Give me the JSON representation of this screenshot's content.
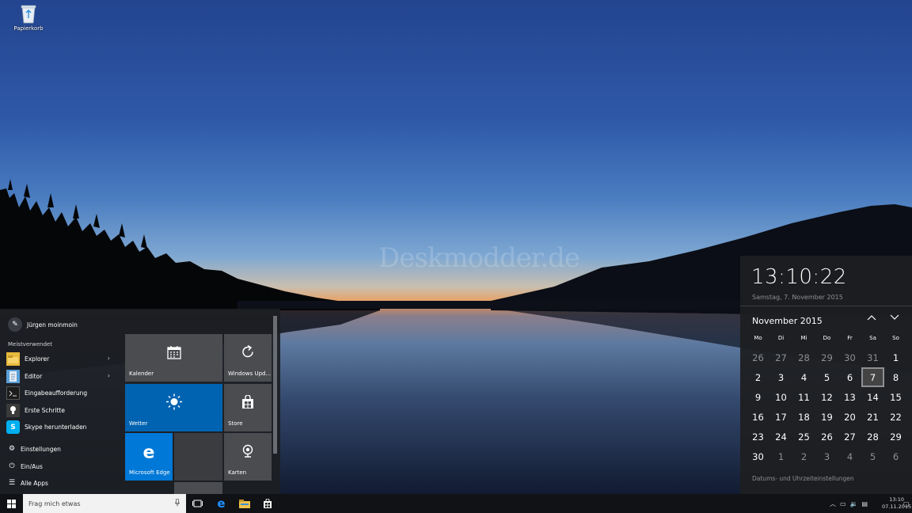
{
  "desktop": {
    "recycle_bin_label": "Papierkorb",
    "watermark": "Deskmodder.de"
  },
  "start_menu": {
    "user_name": "Jürgen moinmoin",
    "most_used_title": "Meistverwendet",
    "apps": [
      {
        "label": "Explorer",
        "icon": "folder-icon",
        "color": "#e7b93c",
        "has_submenu": true
      },
      {
        "label": "Editor",
        "icon": "notepad-icon",
        "color": "#5aa0d8",
        "has_submenu": true
      },
      {
        "label": "Eingabeaufforderung",
        "icon": "command-prompt-icon",
        "color": "#1c1c1c",
        "has_submenu": false
      },
      {
        "label": "Erste Schritte",
        "icon": "lightbulb-icon",
        "color": "#3a3a3a",
        "has_submenu": false
      },
      {
        "label": "Skype herunterladen",
        "icon": "skype-icon",
        "color": "#00aff0",
        "has_submenu": false
      }
    ],
    "settings_label": "Einstellungen",
    "power_label": "Ein/Aus",
    "all_apps_label": "Alle Apps",
    "tiles": [
      {
        "label": "Kalender",
        "icon": "calendar-icon",
        "color": "#4a4c50"
      },
      {
        "label": "Windows Upd...",
        "icon": "refresh-icon",
        "color": "#4a4c50"
      },
      {
        "label": "Wetter",
        "icon": "sun-icon",
        "color": "#0063b1"
      },
      {
        "label": "Store",
        "icon": "store-icon",
        "color": "#4a4c50"
      },
      {
        "label": "Microsoft Edge",
        "icon": "edge-icon",
        "color": "#0078d7"
      },
      {
        "label": "Karten",
        "icon": "camera-icon",
        "color": "#4a4c50"
      }
    ]
  },
  "calendar": {
    "time": "13:10:22",
    "date_full": "Samstag, 7. November 2015",
    "month_label": "November 2015",
    "weekdays": [
      "Mo",
      "Di",
      "Mi",
      "Do",
      "Fr",
      "Sa",
      "So"
    ],
    "days": [
      {
        "d": "26",
        "other": true
      },
      {
        "d": "27",
        "other": true
      },
      {
        "d": "28",
        "other": true
      },
      {
        "d": "29",
        "other": true
      },
      {
        "d": "30",
        "other": true
      },
      {
        "d": "31",
        "other": true
      },
      {
        "d": "1"
      },
      {
        "d": "2"
      },
      {
        "d": "3"
      },
      {
        "d": "4"
      },
      {
        "d": "5"
      },
      {
        "d": "6"
      },
      {
        "d": "7",
        "today": true
      },
      {
        "d": "8"
      },
      {
        "d": "9"
      },
      {
        "d": "10"
      },
      {
        "d": "11"
      },
      {
        "d": "12"
      },
      {
        "d": "13"
      },
      {
        "d": "14"
      },
      {
        "d": "15"
      },
      {
        "d": "16"
      },
      {
        "d": "17"
      },
      {
        "d": "18"
      },
      {
        "d": "19"
      },
      {
        "d": "20"
      },
      {
        "d": "21"
      },
      {
        "d": "22"
      },
      {
        "d": "23"
      },
      {
        "d": "24"
      },
      {
        "d": "25"
      },
      {
        "d": "26"
      },
      {
        "d": "27"
      },
      {
        "d": "28"
      },
      {
        "d": "29"
      },
      {
        "d": "30"
      },
      {
        "d": "1",
        "other": true
      },
      {
        "d": "2",
        "other": true
      },
      {
        "d": "3",
        "other": true
      },
      {
        "d": "4",
        "other": true
      },
      {
        "d": "5",
        "other": true
      },
      {
        "d": "6",
        "other": true
      }
    ],
    "settings_link": "Datums- und Uhrzeiteinstellungen"
  },
  "taskbar": {
    "search_placeholder": "Frag mich etwas",
    "clock_time": "13:10",
    "clock_date": "07.11.2015"
  }
}
